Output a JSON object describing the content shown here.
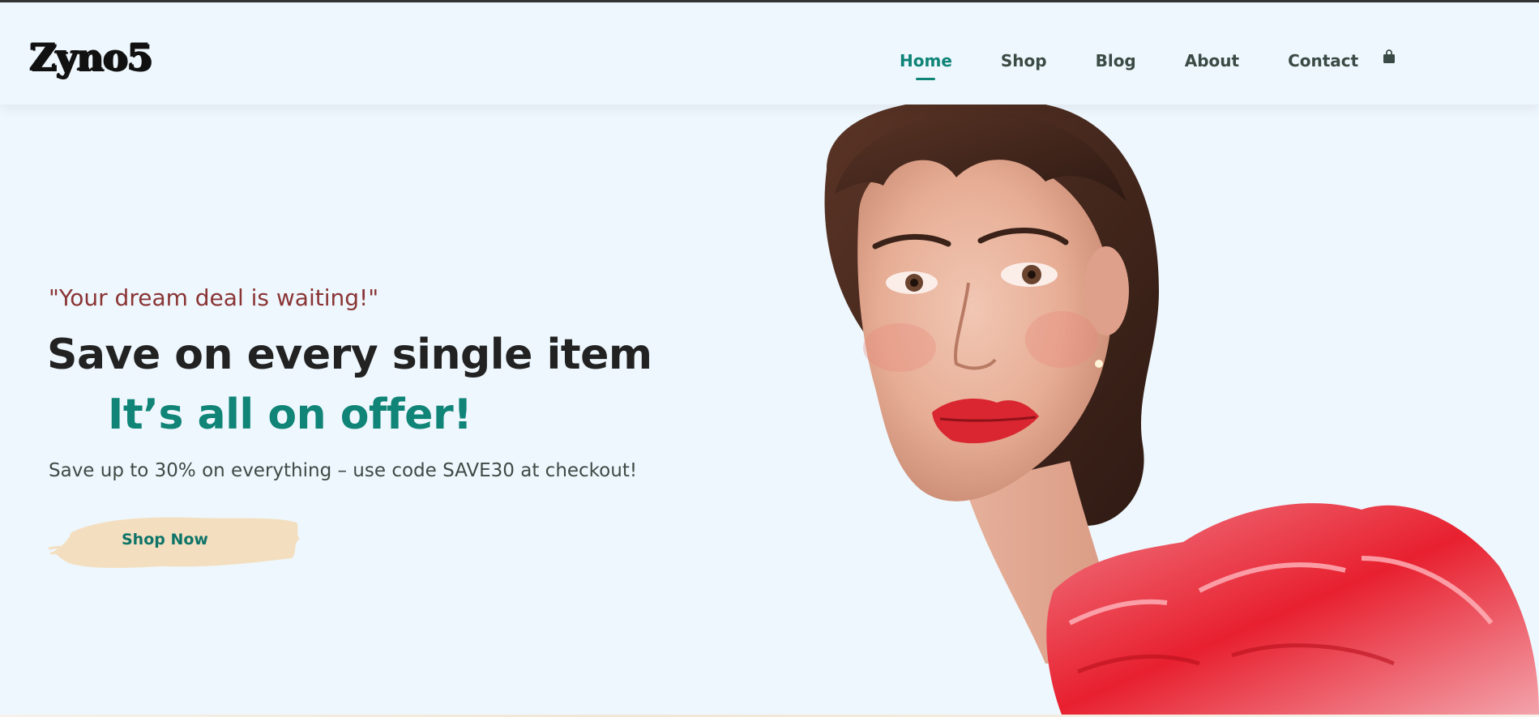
{
  "header": {
    "logo_text": "Zyno5",
    "nav": {
      "home": "Home",
      "shop": "Shop",
      "blog": "Blog",
      "about": "About",
      "contact": "Contact"
    },
    "cart_icon": "shopping-bag-icon",
    "active_item": "Home"
  },
  "hero": {
    "tagline": "\"Your dream deal is waiting!\"",
    "headline": "Save on every single item",
    "subheadline": "It’s all on offer!",
    "promo": "Save up to 30% on everything – use code SAVE30 at checkout!",
    "cta_label": "Shop Now"
  },
  "colors": {
    "background": "#eef7fd",
    "accent_teal": "#0f8477",
    "tagline_red": "#8a3434",
    "headline_dark": "#222222",
    "cta_brush": "#f3dfc0"
  }
}
